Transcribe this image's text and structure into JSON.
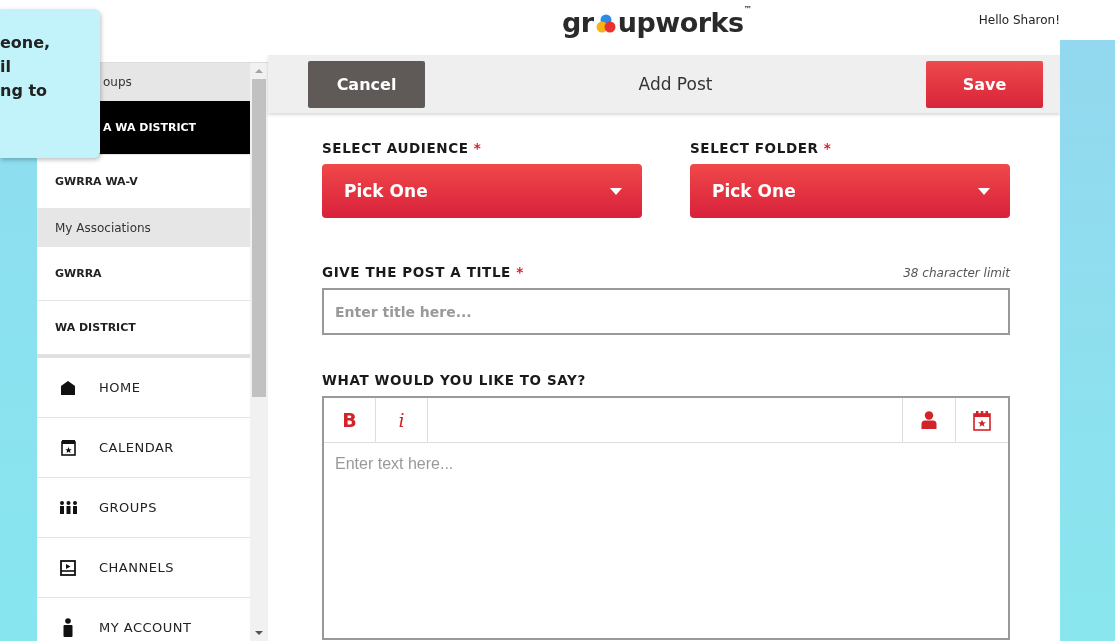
{
  "logo": {
    "before": "gr",
    "after": "upworks",
    "mark": "™"
  },
  "greeting": "Hello Sharon!",
  "tooltip": {
    "lines": [
      "eone,",
      "il",
      "ng to"
    ]
  },
  "sidebar": {
    "items": [
      {
        "kind": "section",
        "label": "oups",
        "covered": true
      },
      {
        "kind": "group",
        "label": "A WA DISTRICT",
        "selected": true,
        "covered": true
      },
      {
        "kind": "group",
        "label": "GWRRA WA-V",
        "selected": false,
        "covered": false
      },
      {
        "kind": "section",
        "label": "My Associations",
        "covered": false
      },
      {
        "kind": "group",
        "label": "GWRRA",
        "selected": false,
        "covered": false
      },
      {
        "kind": "group",
        "label": "WA DISTRICT",
        "selected": false,
        "covered": false
      },
      {
        "kind": "nav",
        "label": "HOME"
      },
      {
        "kind": "nav",
        "label": "CALENDAR"
      },
      {
        "kind": "nav",
        "label": "GROUPS"
      },
      {
        "kind": "nav",
        "label": "CHANNELS"
      },
      {
        "kind": "nav",
        "label": "MY ACCOUNT"
      }
    ]
  },
  "header": {
    "cancel": "Cancel",
    "title": "Add Post",
    "save": "Save"
  },
  "form": {
    "selects": [
      {
        "label": "SELECT AUDIENCE",
        "required_mark": "*",
        "value": "Pick One"
      },
      {
        "label": "SELECT FOLDER",
        "required_mark": "*",
        "value": "Pick One"
      }
    ],
    "title_field": {
      "label": "GIVE THE POST A TITLE",
      "required_mark": "*",
      "hint": "38 character limit",
      "placeholder": "Enter title here..."
    },
    "body_field": {
      "label": "WHAT WOULD YOU LIKE TO SAY?",
      "placeholder": "Enter text here...",
      "toolbar": [
        {
          "kind": "bold",
          "text": "B"
        },
        {
          "kind": "italic",
          "text": "i"
        },
        {
          "kind": "spacer"
        },
        {
          "kind": "person"
        },
        {
          "kind": "calendar"
        }
      ]
    }
  }
}
